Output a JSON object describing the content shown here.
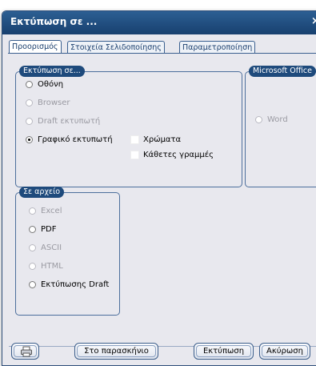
{
  "window": {
    "title": "Εκτύπωση σε ...",
    "close_label": "×"
  },
  "tabs": [
    {
      "label": "Προορισμός",
      "active": true
    },
    {
      "label": "Στοιχεία Σελιδοποίησης",
      "active": false
    },
    {
      "label": "Παραμετροποίηση",
      "active": false
    }
  ],
  "print_to": {
    "legend": "Εκτύπωση σε...",
    "options": [
      {
        "label": "Οθόνη",
        "enabled": true,
        "selected": false
      },
      {
        "label": "Browser",
        "enabled": false,
        "selected": false
      },
      {
        "label": "Draft εκτυπωτή",
        "enabled": false,
        "selected": false
      },
      {
        "label": "Γραφικό εκτυπωτή",
        "enabled": true,
        "selected": true
      }
    ],
    "checkboxes": [
      {
        "label": "Χρώματα",
        "checked": false
      },
      {
        "label": "Κάθετες γραμμές",
        "checked": false
      }
    ]
  },
  "office": {
    "legend": "Microsoft Office",
    "options": [
      {
        "label": "Word",
        "enabled": false,
        "selected": false
      }
    ]
  },
  "to_file": {
    "legend": "Σε αρχείο",
    "options": [
      {
        "label": "Excel",
        "enabled": false,
        "selected": false
      },
      {
        "label": "PDF",
        "enabled": true,
        "selected": false
      },
      {
        "label": "ASCII",
        "enabled": false,
        "selected": false
      },
      {
        "label": "HTML",
        "enabled": false,
        "selected": false
      },
      {
        "label": "Εκτύπωσης Draft",
        "enabled": true,
        "selected": false
      }
    ]
  },
  "buttons": {
    "printer_icon": "printer-icon",
    "background": "Στο παρασκήνιο",
    "print": "Εκτύπωση",
    "cancel": "Ακύρωση"
  },
  "colors": {
    "titlebar": "#1f4d80",
    "legend": "#1e4a7c",
    "dialog": "#e8e8ee"
  }
}
